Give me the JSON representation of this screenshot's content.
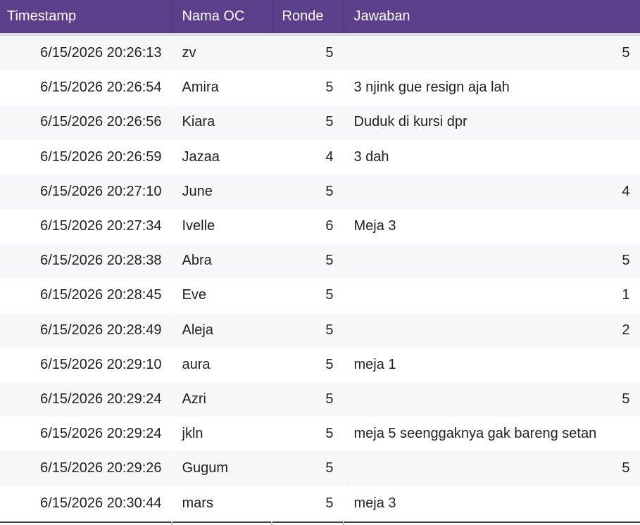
{
  "columns": {
    "timestamp": "Timestamp",
    "nama_oc": "Nama OC",
    "ronde": "Ronde",
    "jawaban": "Jawaban"
  },
  "rows": [
    {
      "timestamp": "6/15/2026 20:26:13",
      "nama_oc": "zv",
      "ronde": "5",
      "jawaban": "5",
      "jawaban_numeric": true
    },
    {
      "timestamp": "6/15/2026 20:26:54",
      "nama_oc": "Amira",
      "ronde": "5",
      "jawaban": "3 njink gue resign aja lah",
      "jawaban_numeric": false
    },
    {
      "timestamp": "6/15/2026 20:26:56",
      "nama_oc": "Kiara",
      "ronde": "5",
      "jawaban": "Duduk di kursi dpr",
      "jawaban_numeric": false
    },
    {
      "timestamp": "6/15/2026 20:26:59",
      "nama_oc": "Jazaa",
      "ronde": "4",
      "jawaban": "3 dah",
      "jawaban_numeric": false
    },
    {
      "timestamp": "6/15/2026 20:27:10",
      "nama_oc": "June",
      "ronde": "5",
      "jawaban": "4",
      "jawaban_numeric": true
    },
    {
      "timestamp": "6/15/2026 20:27:34",
      "nama_oc": "Ivelle",
      "ronde": "6",
      "jawaban": "Meja 3",
      "jawaban_numeric": false
    },
    {
      "timestamp": "6/15/2026 20:28:38",
      "nama_oc": "Abra",
      "ronde": "5",
      "jawaban": "5",
      "jawaban_numeric": true
    },
    {
      "timestamp": "6/15/2026 20:28:45",
      "nama_oc": "Eve",
      "ronde": "5",
      "jawaban": "1",
      "jawaban_numeric": true
    },
    {
      "timestamp": "6/15/2026 20:28:49",
      "nama_oc": "Aleja",
      "ronde": "5",
      "jawaban": "2",
      "jawaban_numeric": true
    },
    {
      "timestamp": "6/15/2026 20:29:10",
      "nama_oc": "aura",
      "ronde": "5",
      "jawaban": "meja 1",
      "jawaban_numeric": false
    },
    {
      "timestamp": "6/15/2026 20:29:24",
      "nama_oc": "Azri",
      "ronde": "5",
      "jawaban": "5",
      "jawaban_numeric": true
    },
    {
      "timestamp": "6/15/2026 20:29:24",
      "nama_oc": "jkln",
      "ronde": "5",
      "jawaban": "meja 5 seenggaknya gak bareng setan",
      "jawaban_numeric": false
    },
    {
      "timestamp": "6/15/2026 20:29:26",
      "nama_oc": "Gugum",
      "ronde": "5",
      "jawaban": "5",
      "jawaban_numeric": true
    },
    {
      "timestamp": "6/15/2026 20:30:44",
      "nama_oc": "mars",
      "ronde": "5",
      "jawaban": "meja 3",
      "jawaban_numeric": false
    }
  ],
  "colors": {
    "header_bg": "#5b3f8a",
    "header_text": "#ffffff",
    "row_alt": "#f5f7fa",
    "row_base": "#ffffff",
    "text": "#202124"
  }
}
